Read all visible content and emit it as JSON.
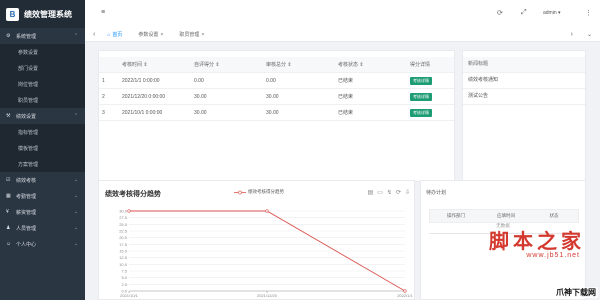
{
  "app": {
    "title": "绩效管理系统",
    "logo_letter": "B"
  },
  "sidebar": {
    "groups": [
      {
        "label": "系统管理",
        "icon": "gear-icon",
        "expanded": true,
        "items": [
          "参数设置",
          "部门设置",
          "岗位管理",
          "职员管理"
        ]
      },
      {
        "label": "绩效设置",
        "icon": "sliders-icon",
        "expanded": true,
        "items": [
          "指标管理",
          "模板管理",
          "方案管理"
        ]
      },
      {
        "label": "绩效考核",
        "icon": "check-icon",
        "expanded": false,
        "items": []
      },
      {
        "label": "考勤管理",
        "icon": "calendar-icon",
        "expanded": false,
        "items": []
      },
      {
        "label": "薪资管理",
        "icon": "money-icon",
        "expanded": false,
        "items": []
      },
      {
        "label": "人员管理",
        "icon": "user-icon",
        "expanded": false,
        "items": []
      },
      {
        "label": "个人中心",
        "icon": "person-icon",
        "expanded": false,
        "items": []
      }
    ]
  },
  "topbar": {
    "user": "admin",
    "user_suffix": "▾"
  },
  "tabs": [
    {
      "label": "首页",
      "active": true
    },
    {
      "label": "参数设置",
      "active": false
    },
    {
      "label": "职员管理",
      "active": false
    }
  ],
  "score_table": {
    "columns": [
      "考核时间",
      "自评得分",
      "审核总分",
      "考核状态",
      "得分详情"
    ],
    "rows": [
      {
        "idx": "1",
        "time": "2022/1/1 0:00:00",
        "self": "0.00",
        "total": "0.00",
        "status": "已结束",
        "action": "考核详情"
      },
      {
        "idx": "2",
        "time": "2021/12/20 0:00:00",
        "self": "30.00",
        "total": "30.00",
        "status": "已结束",
        "action": "考核详情"
      },
      {
        "idx": "3",
        "time": "2021/10/1 0:00:00",
        "self": "30.00",
        "total": "30.00",
        "status": "已结束",
        "action": "考核详情"
      }
    ]
  },
  "notice_panel": {
    "header": "新闻标题",
    "items": [
      "绩效考核通知",
      "测试公告"
    ]
  },
  "chart_panel": {
    "title": "绩效考核得分趋势",
    "tools": [
      "▤",
      "▭",
      "↯",
      "⟳",
      "⇩"
    ]
  },
  "chart_data": {
    "type": "line",
    "categories": [
      "2021/10/1",
      "2021/12/20",
      "2022/1/1"
    ],
    "series": [
      {
        "name": "绩效考核得分趋势",
        "values": [
          30,
          30,
          0
        ],
        "color": "#d9534f"
      }
    ],
    "yticks": [
      "30.0",
      "27.5",
      "25.0",
      "22.5",
      "20.0",
      "17.5",
      "15.0",
      "12.5",
      "10.0",
      "7.5",
      "5.0",
      "2.5",
      "0.0"
    ],
    "ylim": [
      0,
      30
    ],
    "legend": "top-center",
    "grid": true
  },
  "todo_panel": {
    "title": "待办计划",
    "columns": [
      "操作部门",
      "应填时间",
      "状态"
    ],
    "empty_text": "无数据"
  },
  "watermark": {
    "main": "脚本之家",
    "sub": "www.jb51.net",
    "corner": "爪神下载网"
  },
  "colors": {
    "sidebar": "#2b3643",
    "accent": "#1890ff",
    "button": "#1e9d74",
    "line": "#d9534f"
  }
}
